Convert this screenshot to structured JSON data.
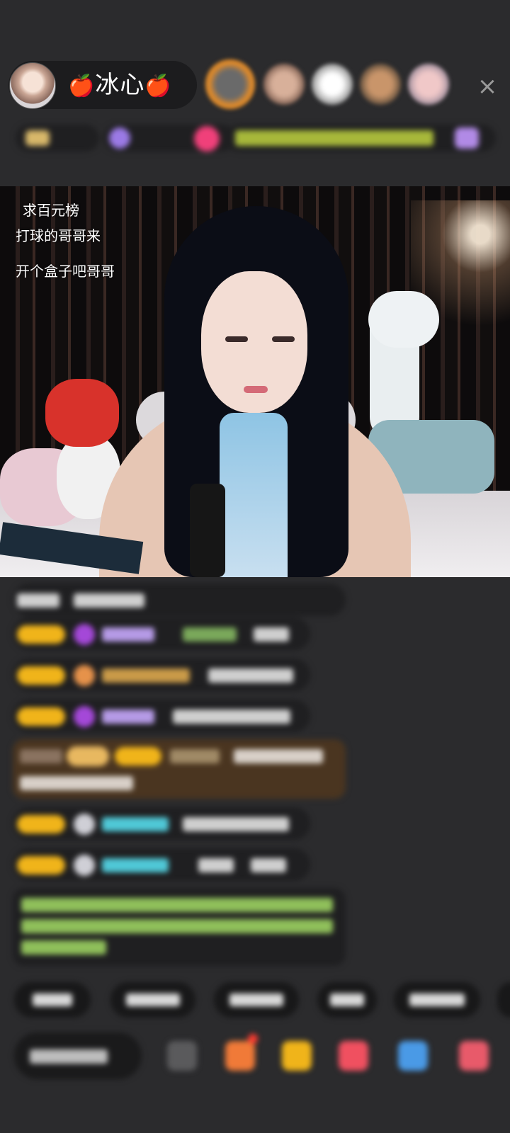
{
  "header": {
    "host_name": "冰心",
    "apple_left": "🍎",
    "apple_right": "🍎",
    "close_icon": "×"
  },
  "video": {
    "overlay_lines": [
      "求百元榜",
      "打球的哥哥来",
      "开个盒子吧哥哥"
    ]
  },
  "colors": {
    "background": "#2b2b2d",
    "badge": "#f0b41a",
    "gift_bg": "#4a3520",
    "notice_text": "#8fbf5a",
    "nick_purple": "#b59ae6",
    "nick_cyan": "#4fc7d6",
    "nick_orange": "#e6a948"
  },
  "icons": [
    "host-avatar-icon",
    "viewer-avatar-icon",
    "close-icon",
    "gem-icon",
    "gift-icon",
    "emoji-icon",
    "share-icon",
    "more-icon"
  ]
}
